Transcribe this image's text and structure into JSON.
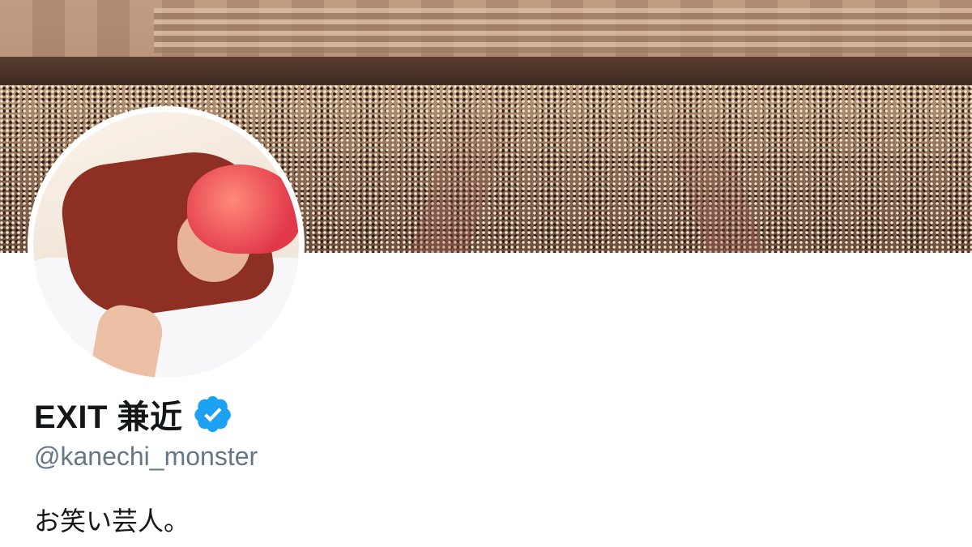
{
  "profile": {
    "display_name": "EXIT 兼近",
    "handle": "@kanechi_monster",
    "bio": "お笑い芸人。",
    "verified": true
  },
  "icons": {
    "verified": "verified-badge-icon"
  },
  "colors": {
    "verified_badge": "#1da1f2",
    "name_text": "#14171a",
    "handle_text": "#657786",
    "background": "#ffffff"
  }
}
